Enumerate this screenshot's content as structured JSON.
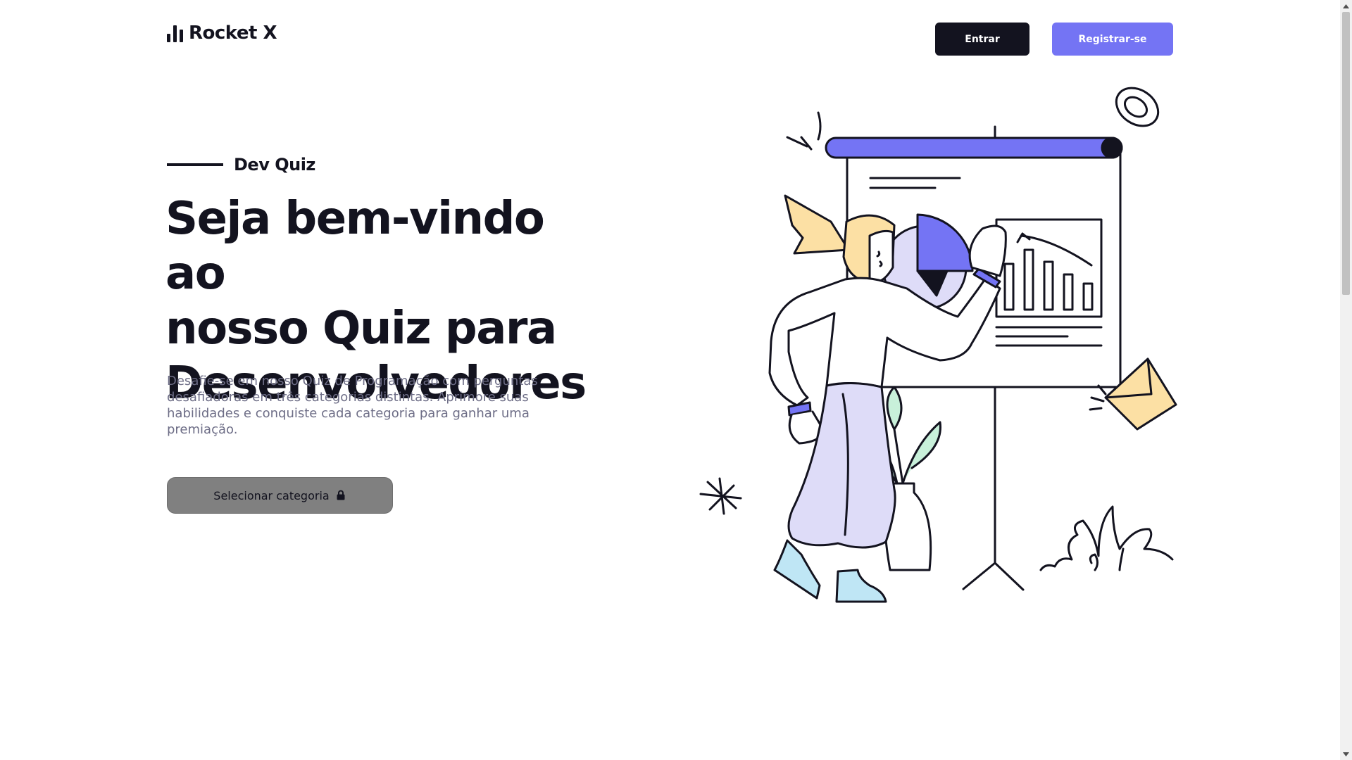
{
  "header": {
    "brand": "Rocket X",
    "login_label": "Entrar",
    "register_label": "Registrar-se"
  },
  "hero": {
    "eyebrow": "Dev Quiz",
    "title_lines": [
      "Seja bem-vindo ao",
      "nosso Quiz para",
      "Desenvolvedores"
    ],
    "description": "Desafie-se em nosso Quiz de Programação com perguntas desafiadoras em três categorias distintas. Aprimore suas habilidades e conquiste cada categoria para ganhar uma premiação.",
    "cta_label": "Selecionar categoria"
  },
  "icons": {
    "logo": "bar-chart-icon",
    "cta": "lock-icon"
  },
  "colors": {
    "dark": "#13131f",
    "accent": "#7474f4",
    "muted_text": "#6d6d86",
    "button_disabled": "#808080",
    "lavender": "#dedcf8",
    "yellow": "#fce0a4",
    "mint": "#c8f0da",
    "light_blue": "#bfe6f5"
  }
}
